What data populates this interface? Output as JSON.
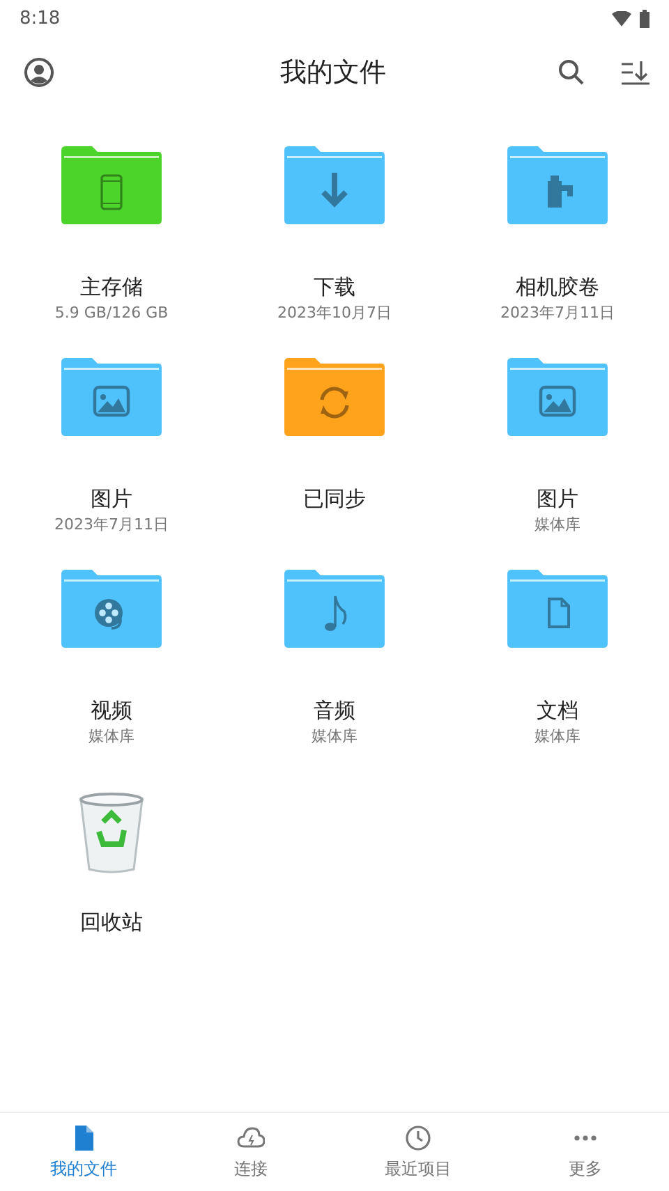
{
  "status_bar": {
    "time": "8:18"
  },
  "app_bar": {
    "title": "我的文件"
  },
  "items": [
    {
      "kind": "storage",
      "color": "#4cd42a",
      "name": "主存储",
      "detail": "5.9 GB/126 GB"
    },
    {
      "kind": "download",
      "color": "#4fc1fb",
      "name": "下载",
      "detail": "2023年10月7日"
    },
    {
      "kind": "camera",
      "color": "#4fc1fb",
      "name": "相机胶卷",
      "detail": "2023年7月11日"
    },
    {
      "kind": "image",
      "color": "#4fc1fb",
      "name": "图片",
      "detail": "2023年7月11日"
    },
    {
      "kind": "sync",
      "color": "#ffa21c",
      "name": "已同步"
    },
    {
      "kind": "image",
      "color": "#4fc1fb",
      "name": "图片",
      "detail": "媒体库"
    },
    {
      "kind": "video",
      "color": "#4fc1fb",
      "name": "视频",
      "detail": "媒体库"
    },
    {
      "kind": "audio",
      "color": "#4fc1fb",
      "name": "音频",
      "detail": "媒体库"
    },
    {
      "kind": "document",
      "color": "#4fc1fb",
      "name": "文档",
      "detail": "媒体库"
    },
    {
      "kind": "trash",
      "name": "回收站"
    }
  ],
  "bottom_nav": [
    {
      "kind": "files",
      "label": "我的文件",
      "selected": true
    },
    {
      "kind": "cloud",
      "label": "连接",
      "selected": false
    },
    {
      "kind": "recent",
      "label": "最近项目",
      "selected": false
    },
    {
      "kind": "more",
      "label": "更多",
      "selected": false
    }
  ]
}
